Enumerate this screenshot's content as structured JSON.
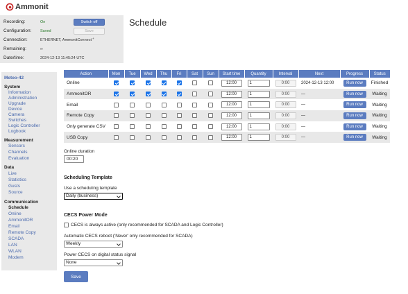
{
  "brand": {
    "name": "Ammonit"
  },
  "status": {
    "recording_label": "Recording:",
    "recording_value": "On",
    "configuration_label": "Configuration:",
    "configuration_value": "Saved",
    "connection_label": "Connection:",
    "connection_value": "ETHERNET, AmmonitConnect",
    "connection_mark": "+",
    "remaining_label": "Remaining:",
    "remaining_value": "∞",
    "datetime_label": "Date/time:",
    "datetime_value": "2024-12-13 11:45:24 UTC",
    "switch_off_label": "Switch off",
    "save_label": "Save"
  },
  "page_title": "Schedule",
  "sidebar": {
    "title": "Meteo-42",
    "system": {
      "heading": "System",
      "items": [
        "Information",
        "Administration",
        "Upgrade",
        "Device",
        "Camera",
        "Switches",
        "Logic Controller",
        "Logbook"
      ]
    },
    "measurement": {
      "heading": "Measurement",
      "items": [
        "Sensors",
        "Channels",
        "Evaluation"
      ]
    },
    "data": {
      "heading": "Data",
      "items": [
        "Live",
        "Statistics",
        "Gusts",
        "Source"
      ]
    },
    "communication": {
      "heading": "Communication",
      "items": [
        "Schedule",
        "Online",
        "AmmonitOR",
        "Email",
        "Remote Copy",
        "SCADA",
        "LAN",
        "WLAN",
        "Modem"
      ]
    }
  },
  "table": {
    "headers": {
      "action": "Action",
      "mon": "Mon",
      "tue": "Tue",
      "wed": "Wed",
      "thu": "Thu",
      "fri": "Fri",
      "sat": "Sat",
      "sun": "Sun",
      "start": "Start time",
      "quantity": "Quantity",
      "interval": "Interval",
      "next": "Next",
      "progress": "Progress",
      "status": "Status"
    },
    "run_label": "Run now",
    "rows": [
      {
        "action": "Online",
        "days": [
          true,
          true,
          true,
          true,
          true,
          false,
          false
        ],
        "start": "12:00",
        "quantity": "1",
        "interval": "0:00",
        "next": "2024-12-13 12:00",
        "status": "Finished"
      },
      {
        "action": "AmmonitOR",
        "days": [
          true,
          true,
          true,
          true,
          true,
          false,
          false
        ],
        "start": "12:00",
        "quantity": "1",
        "interval": "0:00",
        "next": "—",
        "status": "Waiting"
      },
      {
        "action": "Email",
        "days": [
          false,
          false,
          false,
          false,
          false,
          false,
          false
        ],
        "start": "12:00",
        "quantity": "1",
        "interval": "0:00",
        "next": "—",
        "status": "Waiting"
      },
      {
        "action": "Remote Copy",
        "days": [
          false,
          false,
          false,
          false,
          false,
          false,
          false
        ],
        "start": "12:00",
        "quantity": "1",
        "interval": "0:00",
        "next": "—",
        "status": "Waiting"
      },
      {
        "action": "Only generate CSV",
        "days": [
          false,
          false,
          false,
          false,
          false,
          false,
          false
        ],
        "start": "12:00",
        "quantity": "1",
        "interval": "0:00",
        "next": "—",
        "status": "Waiting"
      },
      {
        "action": "USB Copy",
        "days": [
          false,
          false,
          false,
          false,
          false,
          false,
          false
        ],
        "start": "12:00",
        "quantity": "1",
        "interval": "0:00",
        "next": "—",
        "status": "Waiting"
      }
    ]
  },
  "online_duration": {
    "label": "Online duration",
    "value": "00:20"
  },
  "scheduling_template": {
    "heading": "Scheduling Template",
    "label": "Use a scheduling template",
    "selected": "Daily (business)"
  },
  "cecs": {
    "heading": "CECS Power Mode",
    "always_active_label": "CECS is always active (only recommended for SCADA and Logic Controller)",
    "always_active_checked": false,
    "reboot_label": "Automatic CECS reboot ('Never' only recommended for SCADA)",
    "reboot_selected": "Weekly",
    "power_label": "Power CECS on digital status signal",
    "power_selected": "None"
  },
  "save_button": "Save"
}
